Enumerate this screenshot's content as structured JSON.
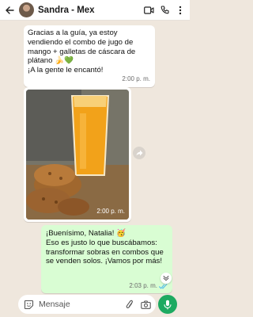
{
  "header": {
    "contact_name": "Sandra - Mex"
  },
  "messages": [
    {
      "type": "incoming",
      "text": "Gracias a la guía, ya estoy vendiendo el combo de jugo de mango + galletas de cáscara de plátano 🍌💚\n¡A la gente le encantó!",
      "time": "2:00 p. m."
    },
    {
      "type": "incoming-image",
      "time": "2:00 p. m."
    },
    {
      "type": "outgoing",
      "text": "¡Buenísimo, Natalia! 🥳\nEso es justo lo que buscábamos: transformar sobras en combos que se venden solos. ¡Vamos por más!",
      "time": "2:03 p. m."
    }
  ],
  "composer": {
    "placeholder": "Mensaje"
  },
  "colors": {
    "accent": "#1daa61",
    "outgoing_bubble": "#d9fdd3",
    "chat_bg": "#efe7dd"
  }
}
